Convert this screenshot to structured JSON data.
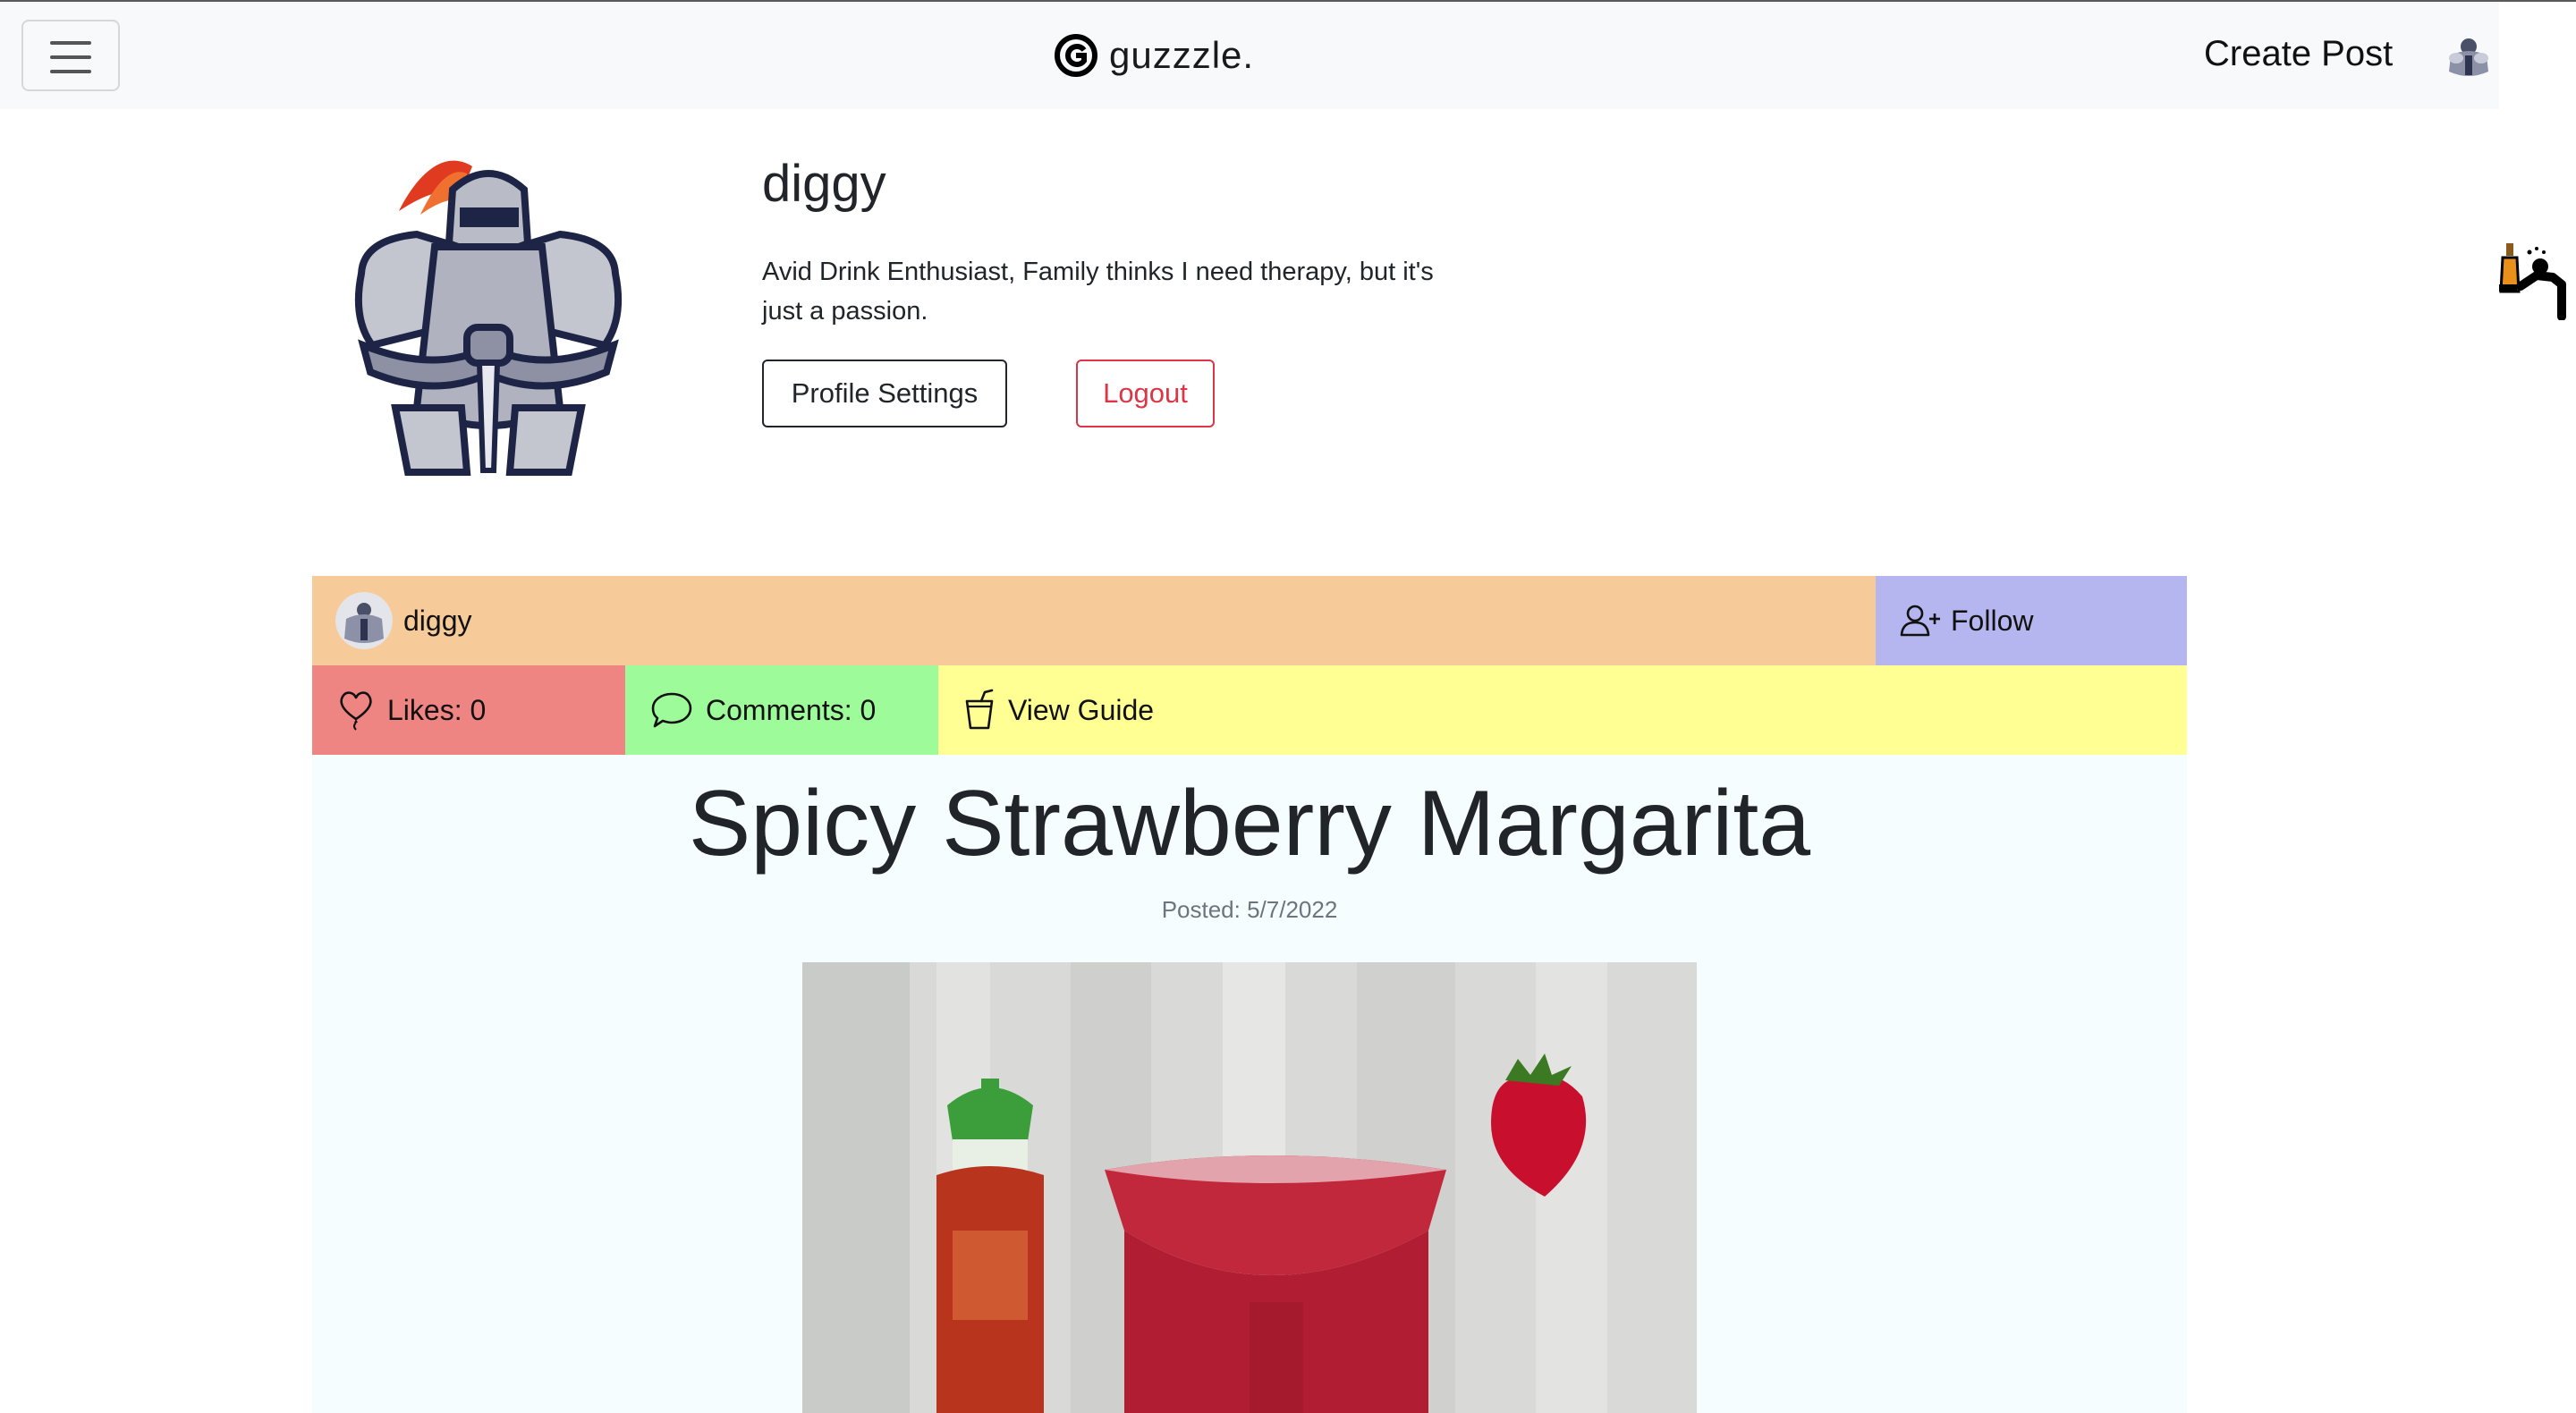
{
  "navbar": {
    "brand": "guzzzle.",
    "create_post": "Create Post"
  },
  "profile": {
    "username": "diggy",
    "bio": "Avid Drink Enthusiast, Family thinks I need therapy, but it's just a passion.",
    "settings_button": "Profile Settings",
    "logout_button": "Logout"
  },
  "post": {
    "author": "diggy",
    "follow_label": "Follow",
    "likes_label": "Likes: 0",
    "comments_label": "Comments: 0",
    "guide_label": "View Guide",
    "title": "Spicy Strawberry Margarita",
    "posted": "Posted: 5/7/2022"
  },
  "icons": {
    "menu": "hamburger-menu-icon",
    "brand": "guzzzle-logo-icon",
    "follow": "person-plus-icon",
    "likes": "balloon-heart-icon",
    "comments": "chat-bubble-icon",
    "guide": "cup-straw-icon"
  },
  "colors": {
    "author_bar": "#f6cb99",
    "follow_bar": "#b5b6f0",
    "likes_bar": "#ee8582",
    "comments_bar": "#9efb9a",
    "guide_bar": "#ffff93",
    "logout": "#dc3545"
  }
}
